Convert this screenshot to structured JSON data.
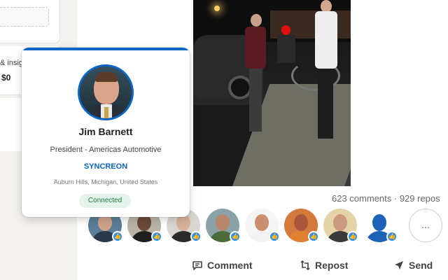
{
  "left_panel": {
    "insights_text": "& insig",
    "amount_text": "$0"
  },
  "post": {
    "social_counts": "623 comments · 929 repos",
    "reactors": [
      {
        "name": "reactor-1",
        "skin": "#d1a28a",
        "top": "#2b3a4a",
        "bg": "#5b7f9a"
      },
      {
        "name": "reactor-2",
        "skin": "#6b4a3a",
        "top": "#1e1e1e",
        "bg": "#b9b3a6"
      },
      {
        "name": "reactor-3",
        "skin": "#d8b19a",
        "top": "#2a2a2a",
        "bg": "#d9d6cf"
      },
      {
        "name": "reactor-4",
        "skin": "#b8876d",
        "top": "#4c6b3a",
        "bg": "#8aa1a8"
      },
      {
        "name": "reactor-5",
        "skin": "#c98f6e",
        "top": "#f2f2f2",
        "bg": "#f5f5f5"
      },
      {
        "name": "reactor-6",
        "skin": "#a8573a",
        "top": "#e08030",
        "bg": "#d47a3d"
      },
      {
        "name": "reactor-7",
        "skin": "#c99a7d",
        "top": "#3a3a3a",
        "bg": "#e6d4a9"
      },
      {
        "name": "reactor-8",
        "skin": "#1c63b8",
        "top": "#1c63b8",
        "bg": "#ffffff"
      }
    ],
    "more_label": "...",
    "like_symbol": "👍",
    "actions": {
      "comment": "Comment",
      "repost": "Repost",
      "send": "Send"
    }
  },
  "hover_card": {
    "name": "Jim Barnett",
    "headline": "President - Americas Automotive",
    "company": "SYNCREON",
    "location": "Auburn Hills, Michigan, United States",
    "status": "Connected"
  },
  "colors": {
    "brand_blue": "#0a66c2",
    "connected_green": "#1a7a3d",
    "like_blue": "#378fe9"
  }
}
